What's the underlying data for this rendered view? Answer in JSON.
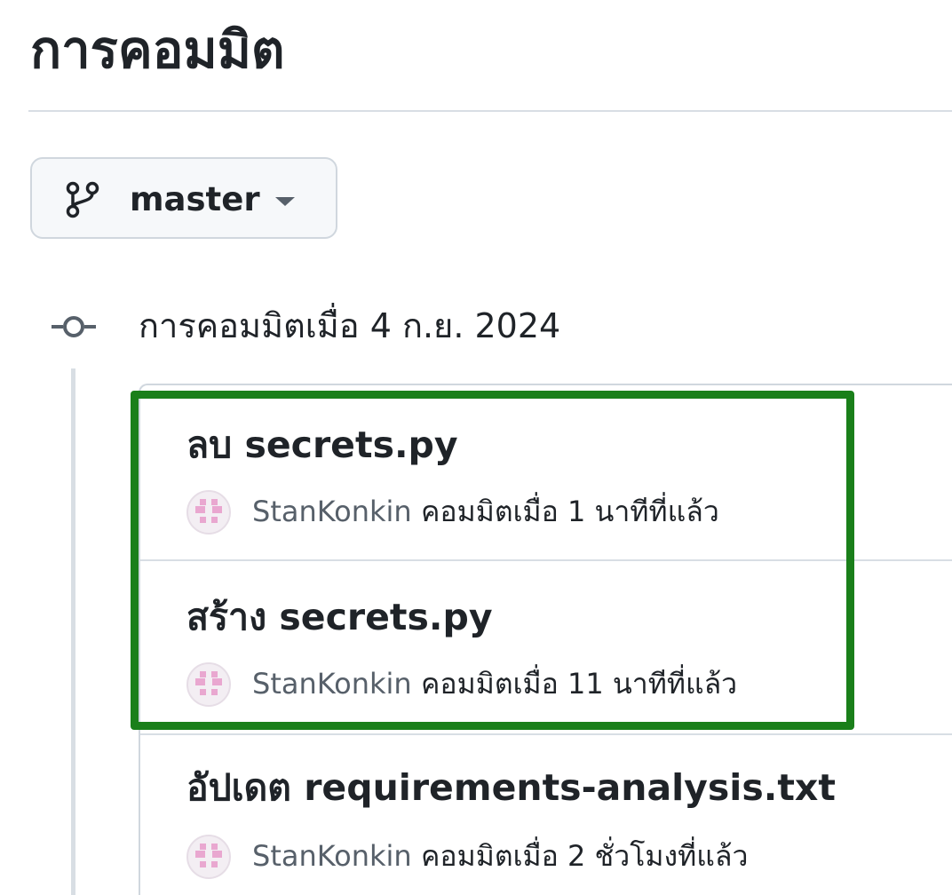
{
  "page": {
    "title": "การคอมมิต"
  },
  "branch": {
    "icon": "git-branch-icon",
    "name": "master",
    "caret_icon": "triangle-down-icon"
  },
  "commit_group": {
    "icon": "git-commit-icon",
    "heading": "การคอมมิตเมื่อ 4 ก.ย. 2024",
    "commits": [
      {
        "verb": "ลบ",
        "file": "secrets.py",
        "author": "StanKonkin",
        "meta": "คอมมิตเมื่อ 1 นาทีที่แล้ว"
      },
      {
        "verb": "สร้าง",
        "file": "secrets.py",
        "author": "StanKonkin",
        "meta": "คอมมิตเมื่อ 11 นาทีที่แล้ว"
      },
      {
        "verb": "อัปเดต",
        "file": "requirements-analysis.txt",
        "author": "StanKonkin",
        "meta": "คอมมิตเมื่อ 2 ชั่วโมงที่แล้ว"
      }
    ]
  },
  "highlight": {
    "color": "#1a7f1a"
  },
  "colors": {
    "text": "#1f2328",
    "muted": "#57606a",
    "border": "#d0d7de",
    "avatar": "#e9a7d0"
  }
}
